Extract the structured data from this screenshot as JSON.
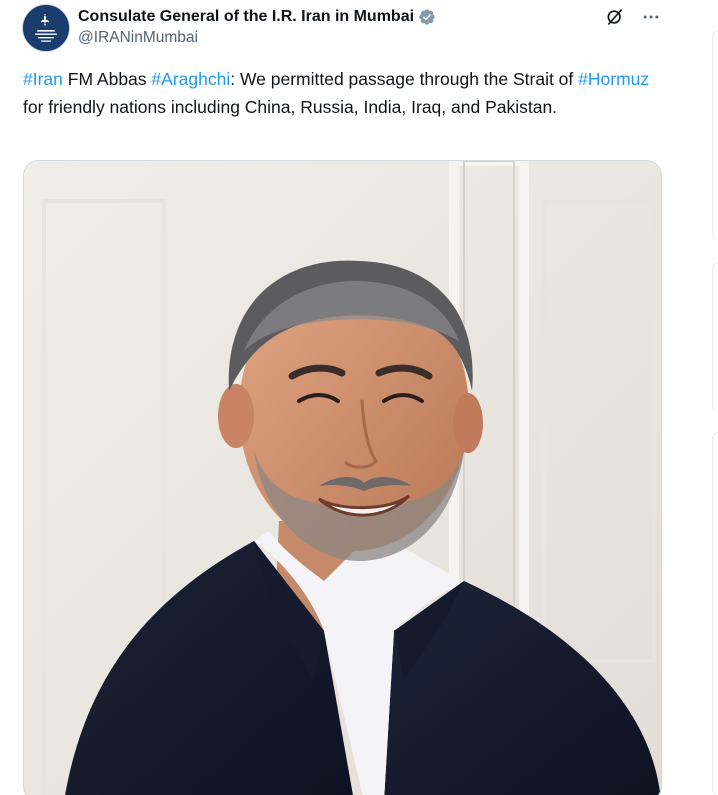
{
  "author": {
    "display_name": "Consulate General of the I.R. Iran in Mumbai",
    "handle": "@IRANinMumbai",
    "verified": true,
    "avatar_icon": "consulate-emblem-logo"
  },
  "actions": {
    "grok_icon": "grok-icon",
    "more_icon": "more-options-icon"
  },
  "tweet": {
    "segments": [
      {
        "text": "#Iran",
        "hashtag": true
      },
      {
        "text": " FM Abbas ",
        "hashtag": false
      },
      {
        "text": "#Araghchi",
        "hashtag": true
      },
      {
        "text": ": We permitted passage through the Strait of ",
        "hashtag": false
      },
      {
        "text": "#Hormuz",
        "hashtag": true
      },
      {
        "text": " for friendly nations including China, Russia, India, Iraq, and Pakistan.",
        "hashtag": false
      }
    ]
  },
  "media": {
    "kind": "photo",
    "subject": "smiling-man-portrait"
  },
  "colors": {
    "accent": "#1d9bf0",
    "text": "#0f1419",
    "secondary": "#536471",
    "border": "#cfd9de"
  }
}
